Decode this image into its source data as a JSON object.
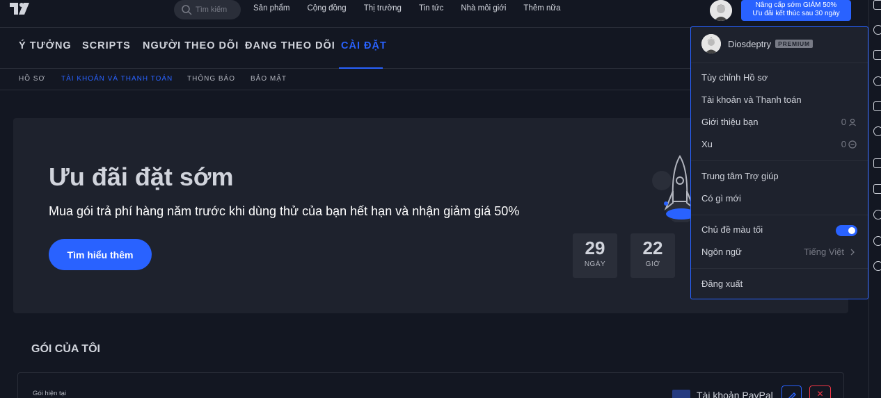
{
  "topbar": {
    "search_placeholder": "Tìm kiếm",
    "nav": [
      "Sản phẩm",
      "Cộng đồng",
      "Thị trường",
      "Tin tức",
      "Nhà môi giới",
      "Thêm nữa"
    ],
    "upgrade_line1": "Nâng cấp sớm GIẢM 50%",
    "upgrade_line2": "Ưu đãi kết thúc sau 30 ngày"
  },
  "tabs": [
    "Ý TƯỞNG",
    "SCRIPTS",
    "NGƯỜI THEO DÕI",
    "ĐANG THEO DÕI",
    "CÀI ĐẶT"
  ],
  "subtabs": [
    "HỒ SƠ",
    "TÀI KHOẢN VÀ THANH TOÁN",
    "THÔNG BÁO",
    "BẢO MẬT"
  ],
  "promo": {
    "title": "Ưu đãi đặt sớm",
    "subtitle": "Mua gói trả phí hàng năm trước khi dùng thử của bạn hết hạn và nhận giảm giá 50%",
    "button": "Tìm hiểu thêm",
    "countdown": [
      {
        "value": "29",
        "unit": "NGÀY"
      },
      {
        "value": "22",
        "unit": "GIỜ"
      }
    ]
  },
  "plan": {
    "section_title": "GÓI CỦA TÔI",
    "current_label": "Gói hiện tại",
    "payment_method": "Tài khoản PayPal"
  },
  "dropdown": {
    "username": "Diosdeptry",
    "badge": "PREMIUM",
    "items": {
      "customize_profile": "Tùy chỉnh Hồ sơ",
      "account_billing": "Tài khoản và Thanh toán",
      "refer_friend": "Giới thiệu bạn",
      "refer_count": "0",
      "coins": "Xu",
      "coins_count": "0",
      "help_center": "Trung tâm Trợ giúp",
      "whats_new": "Có gì mới",
      "dark_theme": "Chủ đề màu tối",
      "language": "Ngôn ngữ",
      "language_value": "Tiếng Việt",
      "logout": "Đăng xuất"
    },
    "dark_theme_on": true
  },
  "colors": {
    "accent": "#2962ff",
    "background": "#131722",
    "panel": "#1e222d",
    "danger": "#f23645"
  }
}
